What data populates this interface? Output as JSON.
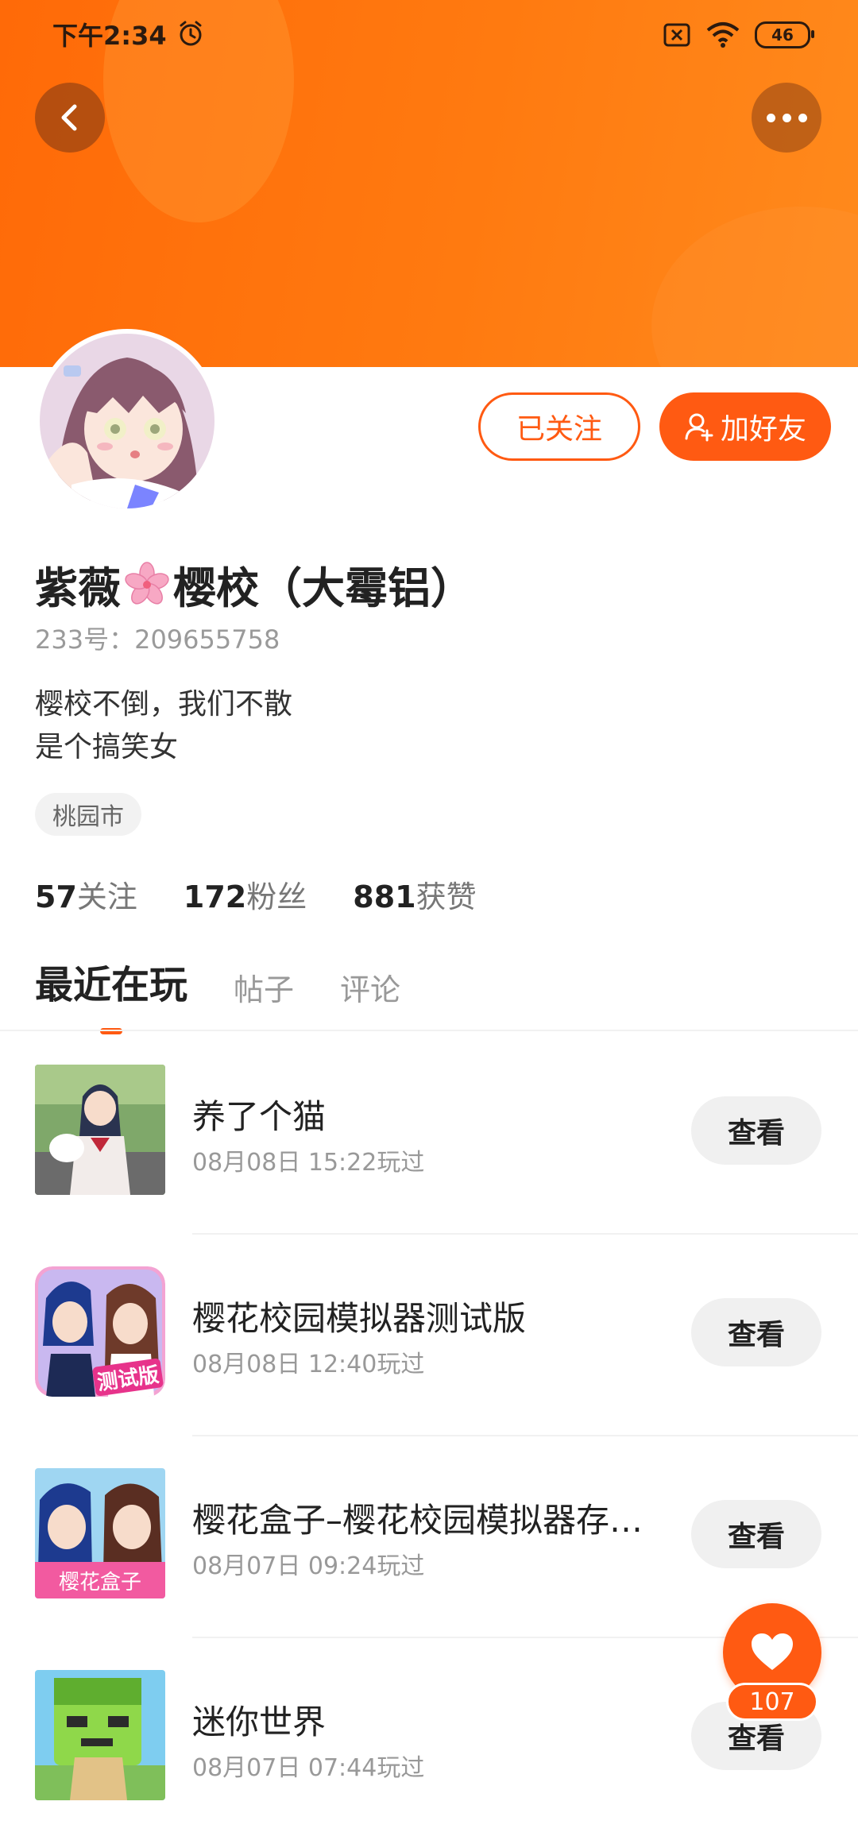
{
  "status_bar": {
    "time": "下午2:34",
    "battery": "46"
  },
  "profile": {
    "name_part1": "紫薇",
    "name_part2": "樱校（大霉铝）",
    "uid": "233号：209655758",
    "bio_line1": "樱校不倒，我们不散",
    "bio_line2": "是个搞笑女",
    "location": "桃园市",
    "follow_label": "已关注",
    "add_friend_label": "加好友"
  },
  "stats": [
    {
      "num": "57",
      "label": "关注"
    },
    {
      "num": "172",
      "label": "粉丝"
    },
    {
      "num": "881",
      "label": "获赞"
    }
  ],
  "tabs": [
    {
      "label": "最近在玩"
    },
    {
      "label": "帖子"
    },
    {
      "label": "评论"
    }
  ],
  "games": [
    {
      "title": "养了个猫",
      "played": "08月08日 15:22玩过",
      "action": "查看"
    },
    {
      "title": "樱花校园模拟器测试版",
      "played": "08月08日 12:40玩过",
      "action": "查看",
      "badge": "测试版"
    },
    {
      "title": "樱花盒子-樱花校园模拟器存档",
      "title_display": "樱花盒子–樱花校园模拟器存…",
      "played": "08月07日 09:24玩过",
      "action": "查看",
      "badge": "樱花盒子"
    },
    {
      "title": "迷你世界",
      "played": "08月07日 07:44玩过",
      "action": "查看"
    }
  ],
  "like": {
    "count": "107"
  },
  "colors": {
    "accent": "#ff5a12",
    "header": "#ff7a10"
  }
}
